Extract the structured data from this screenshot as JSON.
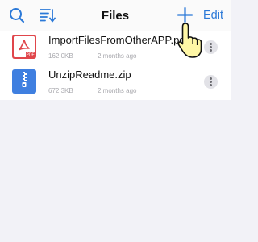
{
  "header": {
    "title": "Files",
    "edit_label": "Edit",
    "icons": {
      "left": [
        "search-icon",
        "sort-list-icon"
      ],
      "right": [
        "add-icon"
      ]
    }
  },
  "files": [
    {
      "name": "ImportFilesFromOtherAPP.pdf",
      "size": "162.0KB",
      "date": "2 months ago",
      "icon": "pdf-file-icon",
      "badge": "PDF"
    },
    {
      "name": "UnzipReadme.zip",
      "size": "672.3KB",
      "date": "2 months ago",
      "icon": "zip-file-icon"
    }
  ],
  "colors": {
    "accent": "#2b79d8",
    "background": "#f2f2f7",
    "pdf_icon": "#e0464b",
    "zip_icon": "#3f7fe0",
    "pointer_fill": "#fff7a6"
  }
}
